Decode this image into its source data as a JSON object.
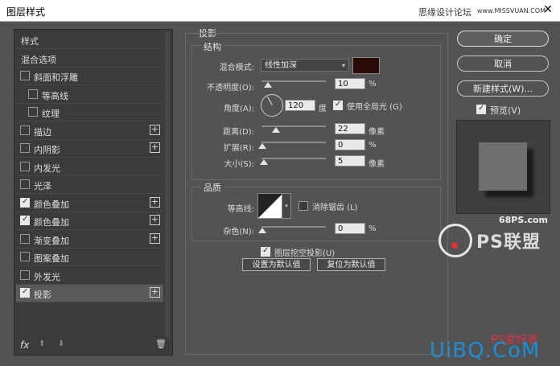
{
  "window": {
    "title": "图层样式",
    "watermark": "思缘设计论坛",
    "watermark_url": "www.MISSVUAN.COM",
    "close": "✕"
  },
  "left_panel": {
    "items": [
      {
        "label": "样式",
        "checkbox": false,
        "checked": false,
        "plus": false,
        "indent": 0,
        "selected": false
      },
      {
        "label": "混合选项",
        "checkbox": false,
        "checked": false,
        "plus": false,
        "indent": 0,
        "selected": false
      },
      {
        "label": "斜面和浮雕",
        "checkbox": true,
        "checked": false,
        "plus": false,
        "indent": 0,
        "selected": false
      },
      {
        "label": "等高线",
        "checkbox": true,
        "checked": false,
        "plus": false,
        "indent": 1,
        "selected": false
      },
      {
        "label": "纹理",
        "checkbox": true,
        "checked": false,
        "plus": false,
        "indent": 1,
        "selected": false
      },
      {
        "label": "描边",
        "checkbox": true,
        "checked": false,
        "plus": true,
        "indent": 0,
        "selected": false
      },
      {
        "label": "内阴影",
        "checkbox": true,
        "checked": false,
        "plus": true,
        "indent": 0,
        "selected": false
      },
      {
        "label": "内发光",
        "checkbox": true,
        "checked": false,
        "plus": false,
        "indent": 0,
        "selected": false
      },
      {
        "label": "光泽",
        "checkbox": true,
        "checked": false,
        "plus": false,
        "indent": 0,
        "selected": false
      },
      {
        "label": "颜色叠加",
        "checkbox": true,
        "checked": true,
        "plus": true,
        "indent": 0,
        "selected": false
      },
      {
        "label": "颜色叠加",
        "checkbox": true,
        "checked": true,
        "plus": true,
        "indent": 0,
        "selected": false
      },
      {
        "label": "渐变叠加",
        "checkbox": true,
        "checked": false,
        "plus": true,
        "indent": 0,
        "selected": false
      },
      {
        "label": "图案叠加",
        "checkbox": true,
        "checked": false,
        "plus": false,
        "indent": 0,
        "selected": false
      },
      {
        "label": "外发光",
        "checkbox": true,
        "checked": false,
        "plus": false,
        "indent": 0,
        "selected": false
      },
      {
        "label": "投影",
        "checkbox": true,
        "checked": true,
        "plus": true,
        "indent": 0,
        "selected": true
      }
    ],
    "fx_label": "fx",
    "up_arrow": "⬆",
    "down_arrow": "⬇",
    "trash": "🗑"
  },
  "drop_shadow": {
    "section_title": "投影",
    "structure": {
      "title": "结构",
      "blend_mode_label": "混合模式:",
      "blend_mode_value": "线性加深",
      "blend_color": "#2a0b07",
      "opacity_label": "不透明度(O):",
      "opacity_value": "10",
      "opacity_unit": "%",
      "opacity_level": 0.1,
      "angle_label": "角度(A):",
      "angle_value": "120",
      "angle_unit": "度",
      "global_light_label": "使用全局光 (G)",
      "global_light_checked": true,
      "distance_label": "距离(D):",
      "distance_value": "22",
      "distance_unit": "像素",
      "spread_label": "扩展(R):",
      "spread_value": "0",
      "spread_unit": "%",
      "size_label": "大小(S):",
      "size_value": "5",
      "size_unit": "像素"
    },
    "quality": {
      "title": "品质",
      "contour_label": "等高线:",
      "anti_alias_label": "消除锯齿 (L)",
      "anti_alias_checked": false,
      "noise_label": "杂色(N):",
      "noise_value": "0",
      "noise_unit": "%"
    },
    "knockout_label": "图层挖空投影(U)",
    "knockout_checked": true,
    "make_default": "设置为默认值",
    "reset_default": "复位为默认值"
  },
  "buttons": {
    "ok": "确定",
    "cancel": "取消",
    "new_style": "新建样式(W)...",
    "preview_label": "预览(V)",
    "preview_checked": true
  },
  "watermarks": {
    "site68": "68PS.com",
    "ps_logo": "PS联盟",
    "uibq": "UiBQ.CoM",
    "uibq_sub": "PS爱好者"
  }
}
